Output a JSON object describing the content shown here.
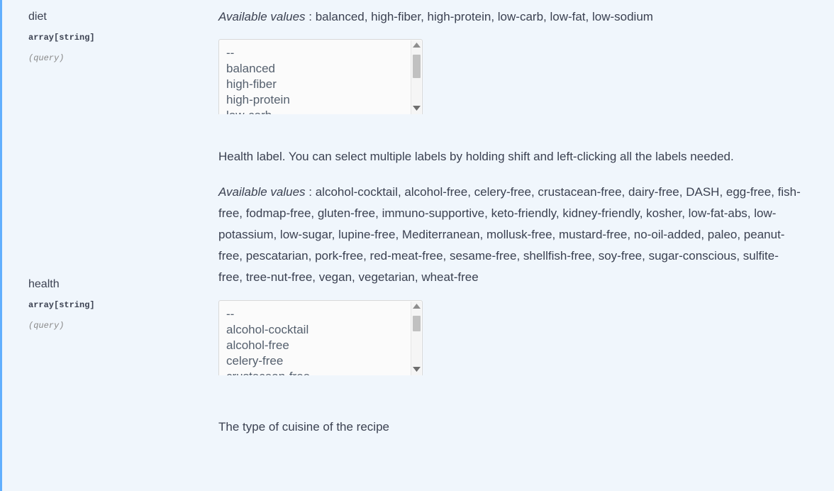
{
  "page": {
    "background_color": "#f0f6fc",
    "accent_border_color": "#61affe"
  },
  "parameters": [
    {
      "name": "diet",
      "type": "array[string]",
      "in": "(query)",
      "description": "",
      "available_values_label": "Available values",
      "available_values_separator": " : ",
      "available_values_text": "balanced, high-fiber, high-protein, low-carb, low-fat, low-sodium",
      "select": {
        "placeholder_option": "--",
        "visible_options": [
          "balanced",
          "high-fiber",
          "high-protein",
          "low-carb"
        ],
        "scroll_thumb_top_pct": 14,
        "scroll_thumb_height_pct": 33
      }
    },
    {
      "name": "health",
      "type": "array[string]",
      "in": "(query)",
      "description": "Health label. You can select multiple labels by holding shift and left-clicking all the labels needed.",
      "available_values_label": "Available values",
      "available_values_separator": " : ",
      "available_values_text": "alcohol-cocktail, alcohol-free, celery-free, crustacean-free, dairy-free, DASH, egg-free, fish-free, fodmap-free, gluten-free, immuno-supportive, keto-friendly, kidney-friendly, kosher, low-fat-abs, low-potassium, low-sugar, lupine-free, Mediterranean, mollusk-free, mustard-free, no-oil-added, paleo, peanut-free, pescatarian, pork-free, red-meat-free, sesame-free, shellfish-free, soy-free, sugar-conscious, sulfite-free, tree-nut-free, vegan, vegetarian, wheat-free",
      "select": {
        "placeholder_option": "--",
        "visible_options": [
          "alcohol-cocktail",
          "alcohol-free",
          "celery-free",
          "crustacean-free"
        ],
        "scroll_thumb_top_pct": 14,
        "scroll_thumb_height_pct": 20
      }
    }
  ],
  "next_parameter_partial": {
    "description": "The type of cuisine of the recipe"
  },
  "icons": {
    "scroll_up": "triangle-up-icon",
    "scroll_down": "triangle-down-icon"
  }
}
